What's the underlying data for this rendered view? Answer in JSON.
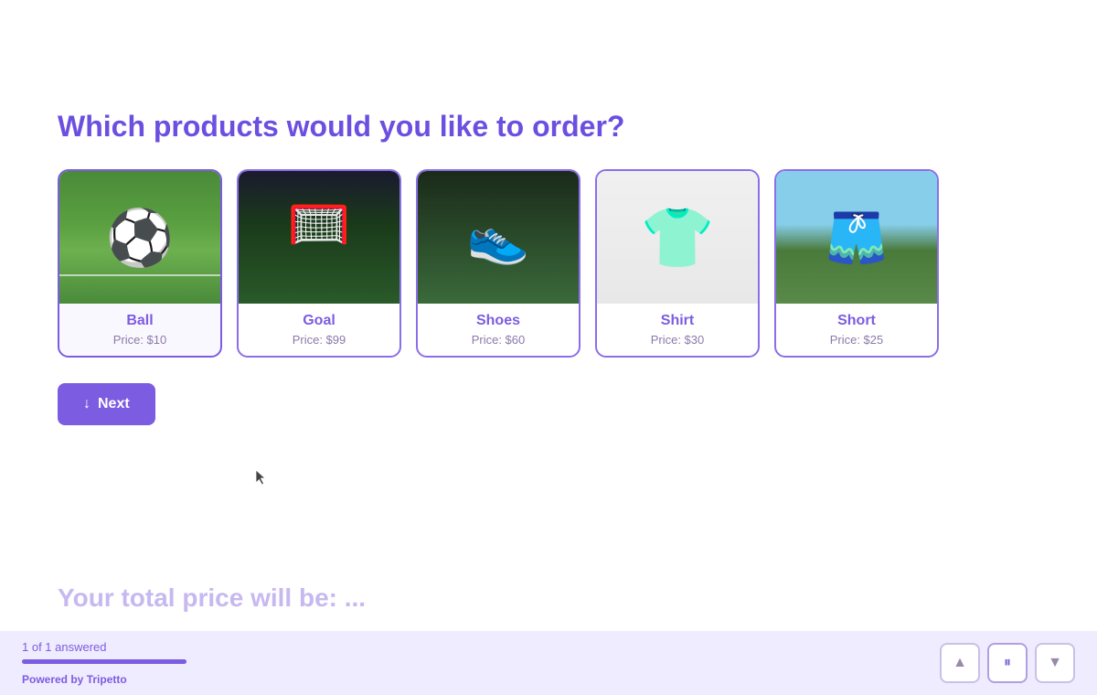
{
  "page": {
    "title": "Which products would you like to order?"
  },
  "products": [
    {
      "id": "ball",
      "name": "Ball",
      "price": "Price: $10",
      "image_class": "img-ball",
      "selected": true
    },
    {
      "id": "goal",
      "name": "Goal",
      "price": "Price: $99",
      "image_class": "img-goal",
      "selected": false
    },
    {
      "id": "shoes",
      "name": "Shoes",
      "price": "Price: $60",
      "image_class": "img-shoes",
      "selected": false
    },
    {
      "id": "shirt",
      "name": "Shirt",
      "price": "Price: $30",
      "image_class": "img-shirt",
      "selected": false
    },
    {
      "id": "short",
      "name": "Short",
      "price": "Price: $25",
      "image_class": "img-short",
      "selected": false
    }
  ],
  "next_button": {
    "label": "Next",
    "icon": "↓"
  },
  "total_price": {
    "label": "Your total price will be: ..."
  },
  "footer": {
    "progress_text": "1 of 1 answered",
    "powered_by_prefix": "Powered by ",
    "powered_by_brand": "Tripetto",
    "progress_percent": 100
  },
  "nav": {
    "up_icon": "▲",
    "pause_icon": "⏸",
    "down_icon": "▼"
  }
}
